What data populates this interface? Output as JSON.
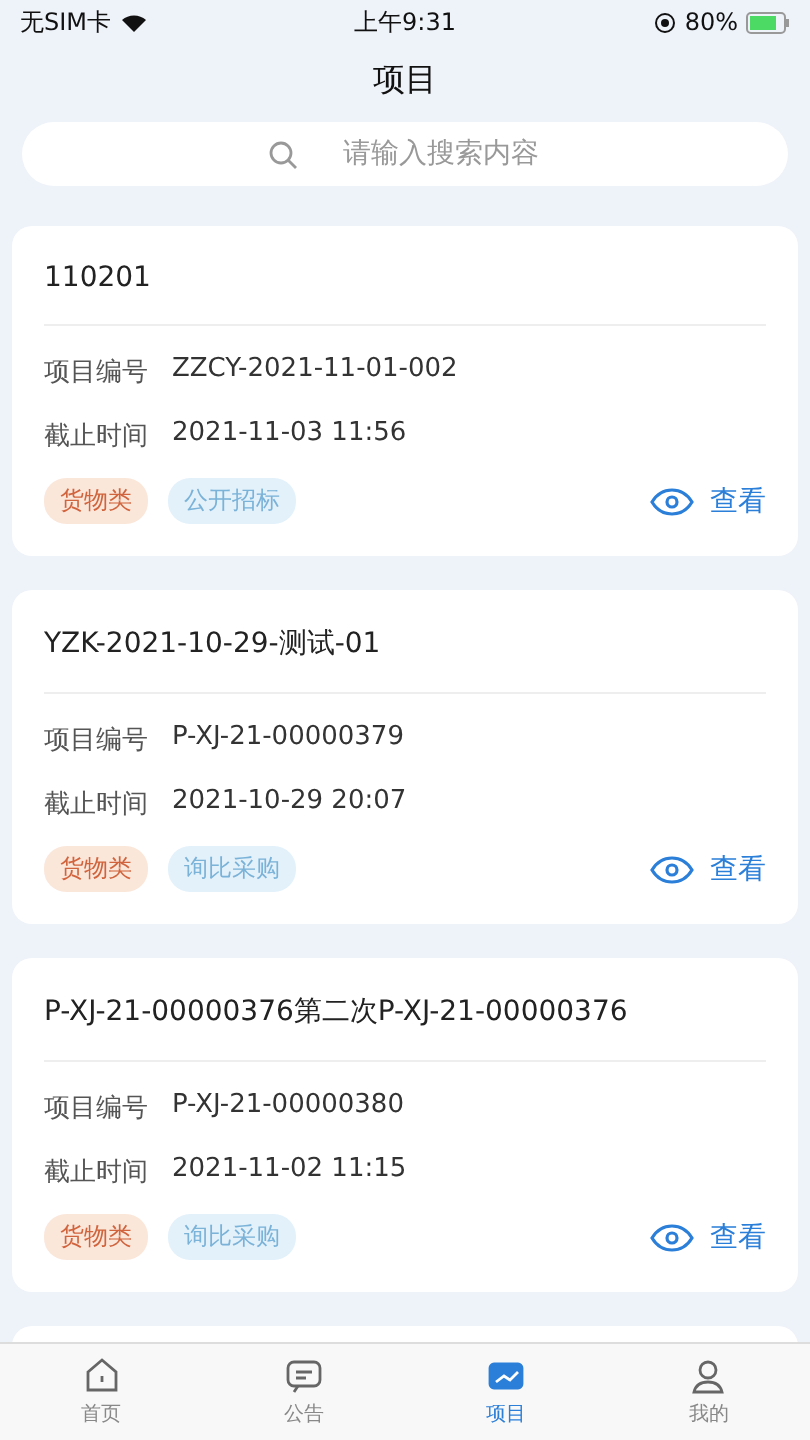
{
  "status_bar": {
    "carrier": "无SIM卡",
    "time": "上午9:31",
    "battery": "80%"
  },
  "header": {
    "title": "项目"
  },
  "search": {
    "placeholder": "请输入搜索内容"
  },
  "projects": [
    {
      "title": "110201",
      "fields": [
        {
          "label": "项目编号",
          "value": "ZZCY-2021-11-01-002"
        },
        {
          "label": "截止时间",
          "value": "2021-11-03 11:56"
        }
      ],
      "tags": [
        {
          "label": "货物类",
          "kind": "category"
        },
        {
          "label": "公开招标",
          "kind": "method"
        }
      ],
      "action": "查看"
    },
    {
      "title": "YZK-2021-10-29-测试-01",
      "fields": [
        {
          "label": "项目编号",
          "value": "P-XJ-21-00000379"
        },
        {
          "label": "截止时间",
          "value": "2021-10-29 20:07"
        }
      ],
      "tags": [
        {
          "label": "货物类",
          "kind": "category"
        },
        {
          "label": "询比采购",
          "kind": "method"
        }
      ],
      "action": "查看"
    },
    {
      "title": "P-XJ-21-00000376第二次P-XJ-21-00000376",
      "fields": [
        {
          "label": "项目编号",
          "value": "P-XJ-21-00000380"
        },
        {
          "label": "截止时间",
          "value": "2021-11-02 11:15"
        }
      ],
      "tags": [
        {
          "label": "货物类",
          "kind": "category"
        },
        {
          "label": "询比采购",
          "kind": "method"
        }
      ],
      "action": "查看"
    }
  ],
  "tab_bar": [
    {
      "label": "首页",
      "selected": false
    },
    {
      "label": "公告",
      "selected": false
    },
    {
      "label": "项目",
      "selected": true
    },
    {
      "label": "我的",
      "selected": false
    }
  ]
}
